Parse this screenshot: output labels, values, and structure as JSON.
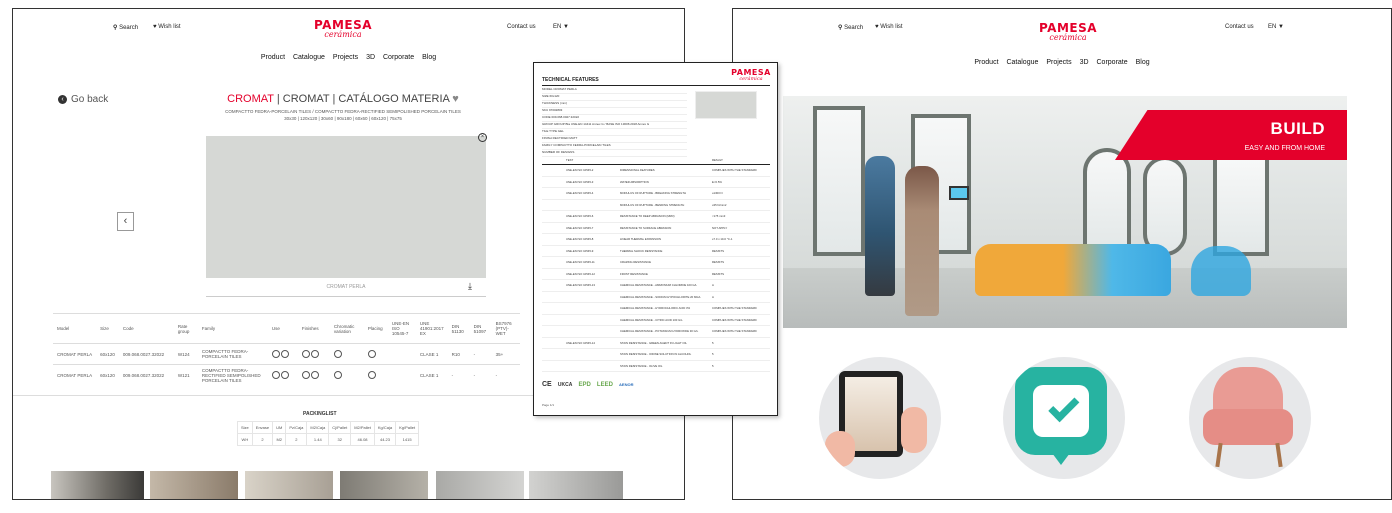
{
  "left_page": {
    "search": "Search",
    "wishlist": "Wish list",
    "brand": "PAMESA",
    "brand_sub": "cerámica",
    "contact": "Contact us",
    "lang": "EN",
    "nav": [
      "Product",
      "Catalogue",
      "Projects",
      "3D",
      "Corporate",
      "Blog"
    ],
    "go_back": "Go back",
    "title_red": "CROMAT",
    "title_rest": " | CROMAT | CATÁLOGO MATERIA",
    "subtitle": "COMPACTTO FEDRA-PORCELAIN TILES / COMPACTTO FEDRA-RECTIFIED SEMIPOLISHED PORCELAIN TILES",
    "sizes": "30x30 | 120x120 | 30x60 | 90x180 | 60x60 | 60x120 | 75x75",
    "image_caption": "CROMAT PERLA",
    "spec_headers": [
      "Model",
      "Size",
      "Code",
      "Rate group",
      "Family",
      "Use",
      "Finishes",
      "Chromatic variation",
      "Placing",
      "UNE-EN ISO 10545-7",
      "UNE 41901:2017 EX",
      "DIN 51130",
      "DIN 51097",
      "BS7976 (PTV)-WET"
    ],
    "spec_rows": [
      [
        "CROMAT PERLA",
        "60x120",
        "009.068.0027.32022",
        "W124",
        "COMPACTTO FEDRA-PORCELAIN TILES",
        "",
        "",
        "",
        "",
        "",
        "CLASE 1",
        "R10",
        "-",
        "35+"
      ],
      [
        "CROMAT PERLA",
        "60x120",
        "009.068.0027.32022",
        "W121",
        "COMPACTTO FEDRA-RECTIFIED SEMIPOLISHED PORCELAIN TILES",
        "",
        "",
        "",
        "",
        "",
        "CLASE 1",
        "-",
        "-",
        "-"
      ]
    ],
    "packinglist_title": "PACKINGLIST",
    "pack_headers": [
      "Size",
      "Envase",
      "UM",
      "Pz/Caja",
      "M2/Caja",
      "Cj/Pallet",
      "M2/Pallet",
      "Kg/Caja",
      "Kg/Pallet"
    ],
    "pack_row": [
      "WH",
      "2",
      "M2",
      "2",
      "1.44",
      "32",
      "46.08",
      "44.23",
      "1415"
    ]
  },
  "sheet": {
    "title": "TECHNICAL FEATURES",
    "brand": "PAMESA",
    "brand_sub": "cerámica",
    "meta": [
      "MODEL  CROMAT PERLA",
      "SIZE  60x120",
      "THICKNESS (mm)",
      "SKU  97002803",
      "CODE  009.068.0027.32022",
      "GROUP  GROUP BIa UNE-EN 14411 Annex G / BASE ISO 13006:2018 Annex G",
      "TILE TYPE  GEL",
      "FINISH  RECTIFIED MATT",
      "FAMILY  COMPACTTO FEDRA-PORCELAIN TILES",
      "NUMBER OF DESIGNS"
    ],
    "head": [
      "TEST",
      "",
      "RESULT"
    ],
    "rows": [
      [
        "UNE-EN ISO 10545-2",
        "DIMENSIONAL FEATURES",
        "COMPLIES WITH THE STANDARD"
      ],
      [
        "UNE-EN ISO 10545-3",
        "WATER ABSORPTION",
        "E<0.5%"
      ],
      [
        "UNE-EN ISO 10545-4",
        "MODULUS OF RUPTURE - BREAKING STRENGTH",
        "≥1300 N"
      ],
      [
        "",
        "MODULUS OF RUPTURE - BENDING STRENGTH",
        "≥35 N/mm2"
      ],
      [
        "UNE-EN ISO 10545-6",
        "RESISTANCE TO DEEP ABRASION (MM3)",
        "<175 mm3"
      ],
      [
        "UNE-EN ISO 10545-7",
        "RESISTANCE TO SURFACE ABRASION",
        "NOT APPLY"
      ],
      [
        "UNE-EN ISO 10545-8",
        "LINEAR THERMAL EXPANSION",
        "≤7.0 x 10-6 °C-1"
      ],
      [
        "UNE-EN ISO 10545-9",
        "THERMAL SHOCK RESISTANCE",
        "RESISTS"
      ],
      [
        "UNE-EN ISO 10545-11",
        "CRAZING RESISTANCE",
        "RESISTS"
      ],
      [
        "UNE-EN ISO 10545-12",
        "FROST RESISTANCE",
        "RESISTS"
      ],
      [
        "UNE-EN ISO 10545-13",
        "CHEMICAL RESISTANCE - AMMONIUM CHLORIDE 100 G/L",
        "A"
      ],
      [
        "",
        "CHEMICAL RESISTANCE - SODIUM HYPOCHLORITE 20 MG/L",
        "A"
      ],
      [
        "",
        "CHEMICAL RESISTANCE - HYDROCHLORIC ACID 3%",
        "COMPLIES WITH THE STANDARD"
      ],
      [
        "",
        "CHEMICAL RESISTANCE - CITRIC ACID 100 G/L",
        "COMPLIES WITH THE STANDARD"
      ],
      [
        "",
        "CHEMICAL RESISTANCE - POTASSIUM HYDROXIDE 30 G/L",
        "COMPLIES WITH THE STANDARD"
      ],
      [
        "UNE-EN ISO 10545-14",
        "STAIN RESISTANCE - GREEN AGENT IN LIGHT OIL",
        "5"
      ],
      [
        "",
        "STAIN RESISTANCE - IODINE SOLUTION IN ALCOHOL",
        "5"
      ],
      [
        "",
        "STAIN RESISTANCE - OLIVE OIL",
        "5"
      ]
    ],
    "certs": [
      "CE",
      "UKCA",
      "EPD",
      "LEED",
      "AENOR"
    ],
    "page": "Page 1/1"
  },
  "right_page": {
    "search": "Search",
    "wishlist": "Wish list",
    "brand": "PAMESA",
    "brand_sub": "cerámica",
    "contact": "Contact us",
    "lang": "EN",
    "nav": [
      "Product",
      "Catalogue",
      "Projects",
      "3D",
      "Corporate",
      "Blog"
    ],
    "banner_title": "BUILD",
    "banner_sub": "EASY AND FROM HOME"
  },
  "colors": {
    "brand_red": "#e4002b",
    "tile_grey": "#d6d8d5",
    "check_green": "#27b3a1",
    "chair_pink": "#e99b94",
    "sofa_yellow": "#f0a83a"
  }
}
